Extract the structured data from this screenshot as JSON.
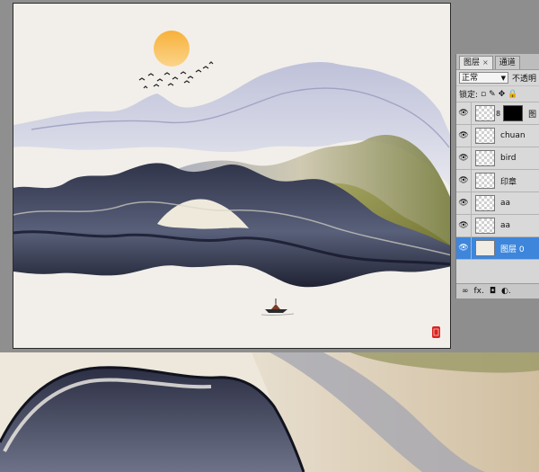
{
  "panel": {
    "tabs": [
      {
        "label": "图层",
        "close": "×"
      },
      {
        "label": "通道"
      }
    ],
    "blend_mode": "正常",
    "opacity_label": "不透明",
    "lock_label": "锁定:",
    "layers": [
      {
        "name": "图",
        "kind": "mask"
      },
      {
        "name": "chuan",
        "kind": "transparent"
      },
      {
        "name": "bird",
        "kind": "transparent"
      },
      {
        "name": "印章",
        "kind": "transparent"
      },
      {
        "name": "aa",
        "kind": "transparent"
      },
      {
        "name": "aa",
        "kind": "transparent"
      },
      {
        "name": "图层 0",
        "kind": "paper",
        "selected": true
      }
    ],
    "bottom_icons": [
      "link-icon",
      "fx-icon",
      "mask-icon",
      "adjustment-icon"
    ],
    "bottom_labels": {
      "link": "∞",
      "fx": "fx.",
      "mask": "◘",
      "adjust": "◐."
    }
  },
  "colors": {
    "paper": "#f2efea",
    "sun": "#f6b545",
    "selection": "#3d86dc",
    "seal": "#d8231f",
    "mountain_dark": "#3a3f58",
    "mountain_light": "#c8cadc",
    "moss": "#8c8f3c"
  }
}
